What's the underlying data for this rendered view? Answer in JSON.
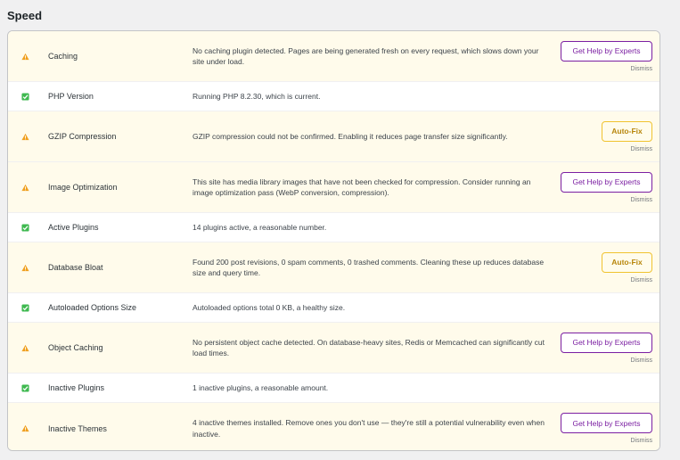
{
  "section": {
    "title": "Speed"
  },
  "colors": {
    "warning": "#f0a020",
    "ok": "#3fb950",
    "experts_accent": "#7b1fa2",
    "autofix_accent": "#f0c330"
  },
  "actions": {
    "experts_label": "Get Help by Experts",
    "autofix_label": "Auto-Fix",
    "dismiss_label": "Dismiss"
  },
  "rows": [
    {
      "status": "warning",
      "icon": "warning-icon",
      "label": "Caching",
      "description": "No caching plugin detected. Pages are being generated fresh on every request, which slows down your site under load.",
      "action": "experts"
    },
    {
      "status": "ok",
      "icon": "check-icon",
      "label": "PHP Version",
      "description": "Running PHP 8.2.30, which is current.",
      "action": ""
    },
    {
      "status": "warning",
      "icon": "warning-icon",
      "label": "GZIP Compression",
      "description": "GZIP compression could not be confirmed. Enabling it reduces page transfer size significantly.",
      "action": "autofix"
    },
    {
      "status": "warning",
      "icon": "warning-icon",
      "label": "Image Optimization",
      "description": "This site has media library images that have not been checked for compression. Consider running an image optimization pass (WebP conversion, compression).",
      "action": "experts"
    },
    {
      "status": "ok",
      "icon": "check-icon",
      "label": "Active Plugins",
      "description": "14 plugins active, a reasonable number.",
      "action": ""
    },
    {
      "status": "warning",
      "icon": "warning-icon",
      "label": "Database Bloat",
      "description": "Found 200 post revisions, 0 spam comments, 0 trashed comments. Cleaning these up reduces database size and query time.",
      "action": "autofix"
    },
    {
      "status": "ok",
      "icon": "check-icon",
      "label": "Autoloaded Options Size",
      "description": "Autoloaded options total 0 KB, a healthy size.",
      "action": ""
    },
    {
      "status": "warning",
      "icon": "warning-icon",
      "label": "Object Caching",
      "description": "No persistent object cache detected. On database-heavy sites, Redis or Memcached can significantly cut load times.",
      "action": "experts"
    },
    {
      "status": "ok",
      "icon": "check-icon",
      "label": "Inactive Plugins",
      "description": "1 inactive plugins, a reasonable amount.",
      "action": ""
    },
    {
      "status": "warning",
      "icon": "warning-icon",
      "label": "Inactive Themes",
      "description": "4 inactive themes installed. Remove ones you don't use — they're still a potential vulnerability even when inactive.",
      "action": "experts"
    }
  ]
}
